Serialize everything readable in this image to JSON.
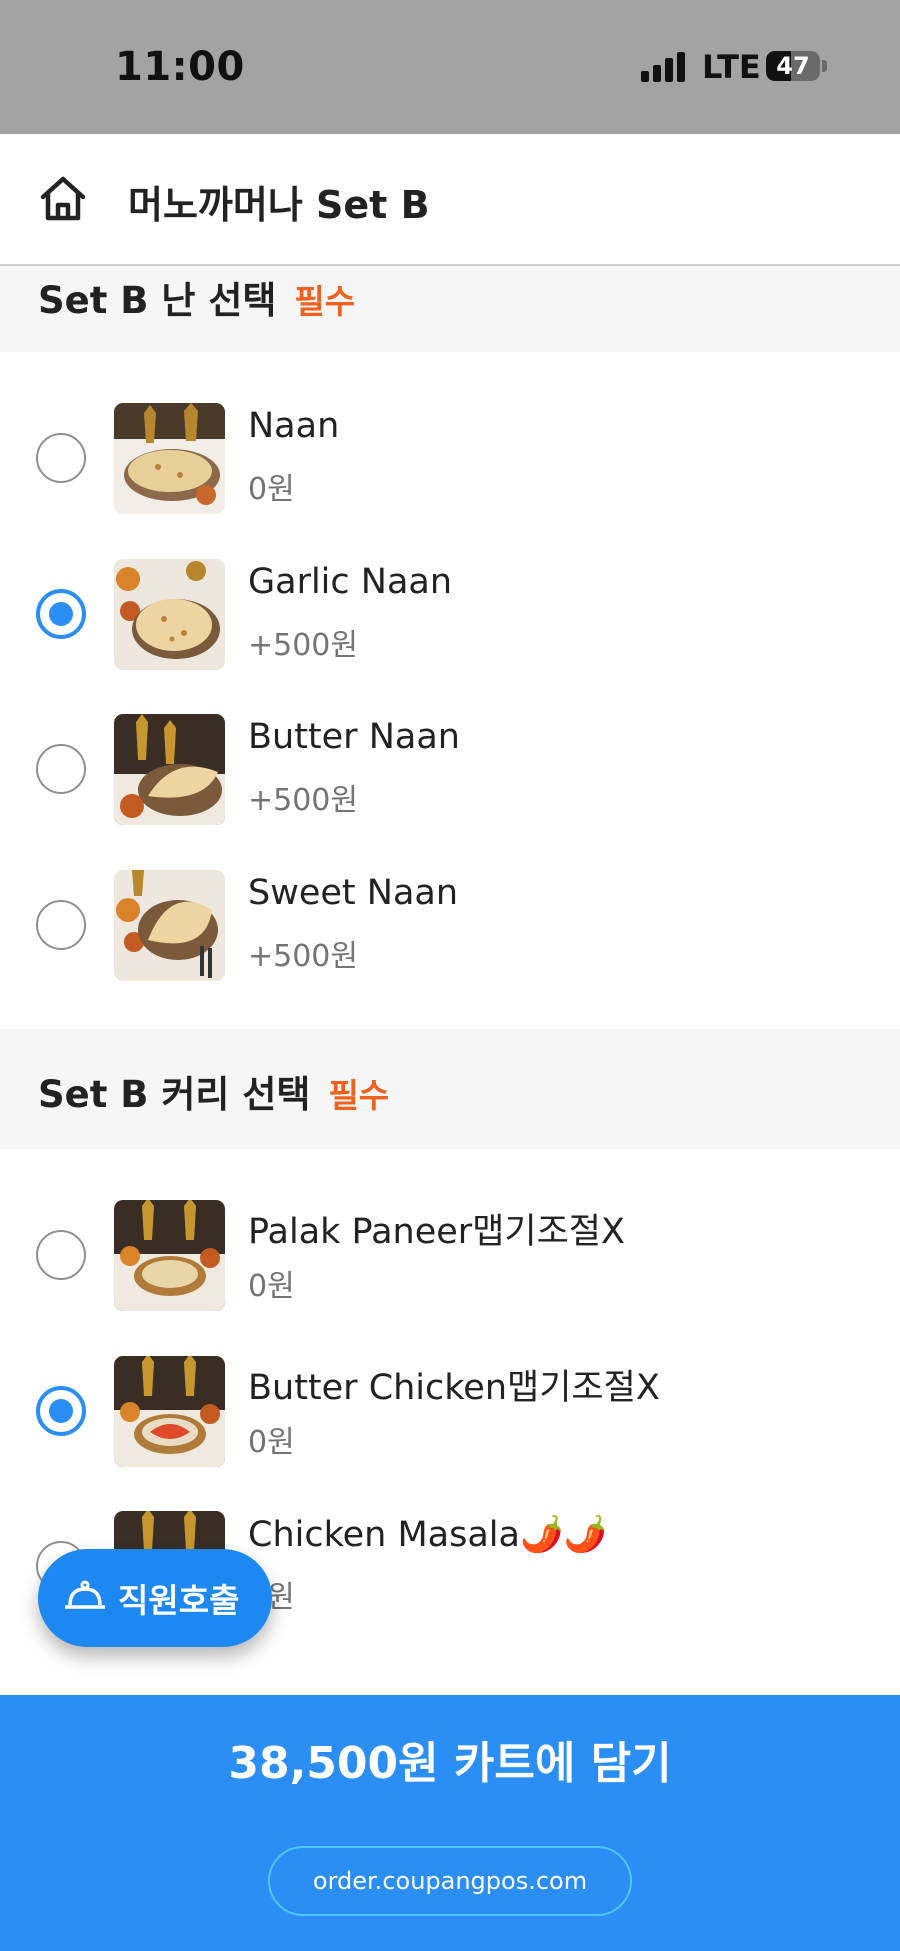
{
  "status_bar": {
    "time": "11:00",
    "network": "LTE",
    "battery": "47",
    "battery_level": 0.47
  },
  "header": {
    "title": "머노까머나 Set B",
    "home_icon": "home-icon"
  },
  "sections": [
    {
      "title": "Set B 난 선택",
      "badge": "필수",
      "options": [
        {
          "name": "Naan",
          "price": "0원",
          "selected": false
        },
        {
          "name": "Garlic Naan",
          "price": "+500원",
          "selected": true
        },
        {
          "name": "Butter Naan",
          "price": "+500원",
          "selected": false
        },
        {
          "name": "Sweet Naan",
          "price": "+500원",
          "selected": false
        }
      ]
    },
    {
      "title": "Set B 커리 선택",
      "badge": "필수",
      "options": [
        {
          "name": "Palak Paneer맵기조절X",
          "price": "0원",
          "selected": false
        },
        {
          "name": "Butter Chicken맵기조절X",
          "price": "0원",
          "selected": true
        },
        {
          "name": "Chicken Masala🌶️🌶️",
          "price": "0원",
          "selected": false
        }
      ]
    }
  ],
  "staff_call": {
    "label": "직원호출",
    "icon": "service-bell-icon"
  },
  "cart": {
    "label": "38,500원 카트에 담기"
  },
  "footer": {
    "url": "order.coupangpos.com"
  },
  "colors": {
    "accent": "#2a8ef5",
    "required": "#f0611e",
    "status_bar": "#a3a3a3"
  }
}
